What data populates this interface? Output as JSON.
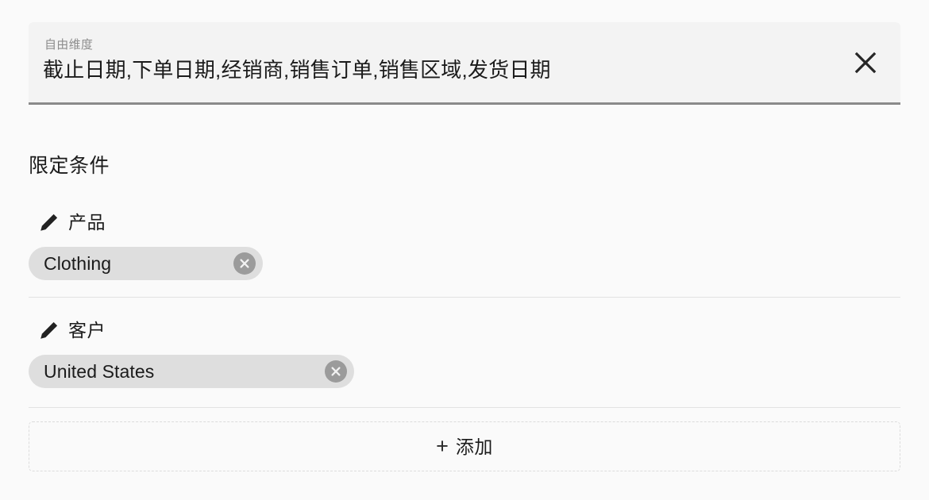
{
  "free_dimension": {
    "label": "自由维度",
    "value": "截止日期,下单日期,经销商,销售订单,销售区域,发货日期",
    "clear_icon": "close-icon"
  },
  "conditions": {
    "title": "限定条件",
    "groups": [
      {
        "edit_icon": "pencil-icon",
        "name": "产品",
        "chips": [
          {
            "text": "Clothing",
            "remove_icon": "circle-close-icon"
          }
        ]
      },
      {
        "edit_icon": "pencil-icon",
        "name": "客户",
        "chips": [
          {
            "text": "United States",
            "remove_icon": "circle-close-icon"
          }
        ]
      }
    ]
  },
  "add_button": {
    "plus": "+",
    "label": "添加",
    "icon": "plus-icon"
  },
  "colors": {
    "page_background": "#fafafa",
    "panel_background": "#f3f3f3",
    "panel_underline": "#8a8a8a",
    "chip_background": "#dedede",
    "chip_remove_background": "#9b9b9b",
    "divider": "#e2e2e2",
    "dashed_border": "#dcdcdc",
    "text_primary": "#1b1b1b",
    "text_muted": "#8c8c8c"
  }
}
